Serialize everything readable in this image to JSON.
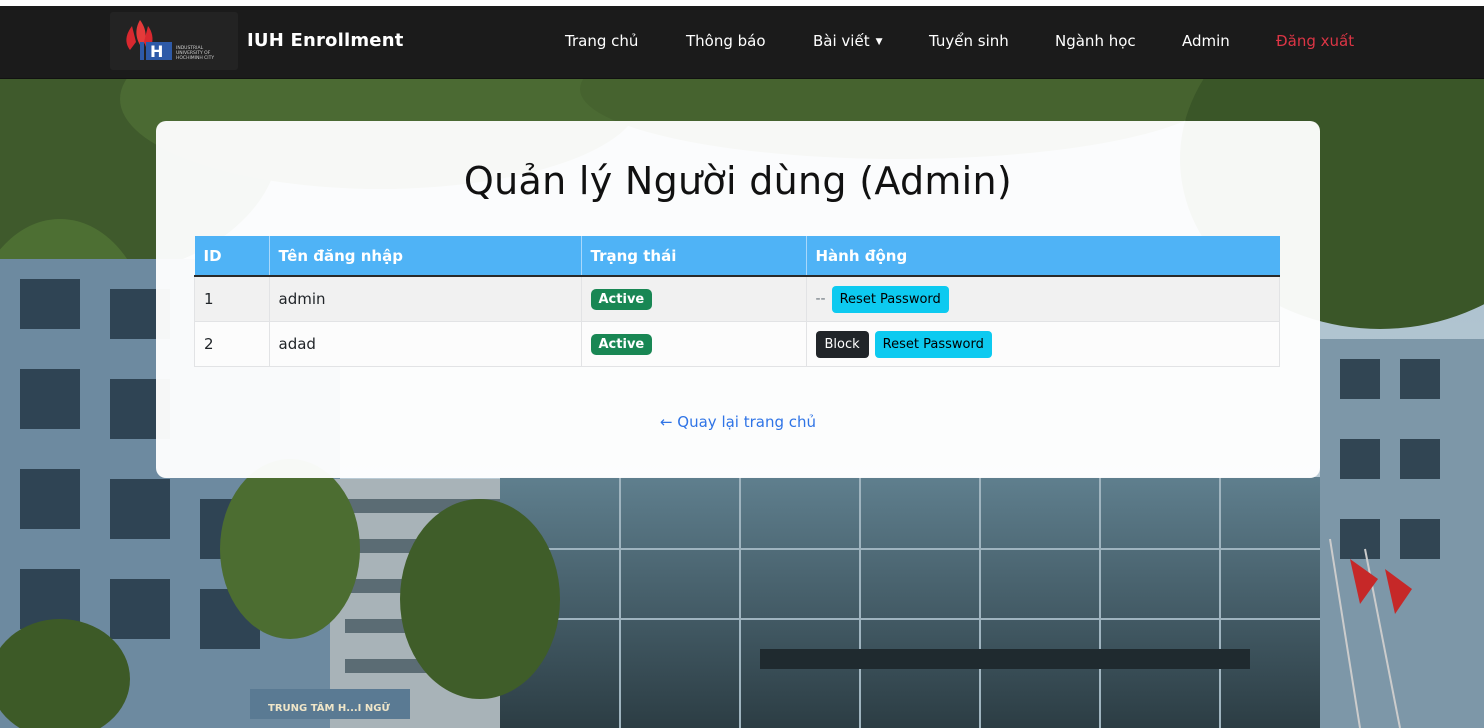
{
  "nav": {
    "brand": "IUH Enrollment",
    "logo_text": [
      "INDUSTRIAL",
      "UNIVERSITY OF",
      "HOCHIMINH CITY"
    ],
    "items": [
      {
        "label": "Trang chủ"
      },
      {
        "label": "Thông báo"
      },
      {
        "label": "Bài viết"
      },
      {
        "label": "Tuyển sinh"
      },
      {
        "label": "Ngành học"
      },
      {
        "label": "Admin"
      },
      {
        "label": "Đăng xuất"
      }
    ]
  },
  "page": {
    "title": "Quản lý Người dùng (Admin)",
    "back_link": "← Quay lại trang chủ"
  },
  "table": {
    "headers": [
      "ID",
      "Tên đăng nhập",
      "Trạng thái",
      "Hành động"
    ],
    "rows": [
      {
        "id": "1",
        "username": "admin",
        "status": "Active",
        "block_label": "--",
        "reset_label": "Reset Password"
      },
      {
        "id": "2",
        "username": "adad",
        "status": "Active",
        "block_label": "Block",
        "reset_label": "Reset Password"
      }
    ]
  },
  "background_sign": "TRUNG TÂM H...I NGỮ",
  "colors": {
    "navbar": "#1b1b1b",
    "table_header": "#4fb3f6",
    "status_active": "#198754",
    "reset_button": "#0dcaf0",
    "block_button": "#212529",
    "logout": "#dc3545",
    "link": "#2f74e6"
  }
}
